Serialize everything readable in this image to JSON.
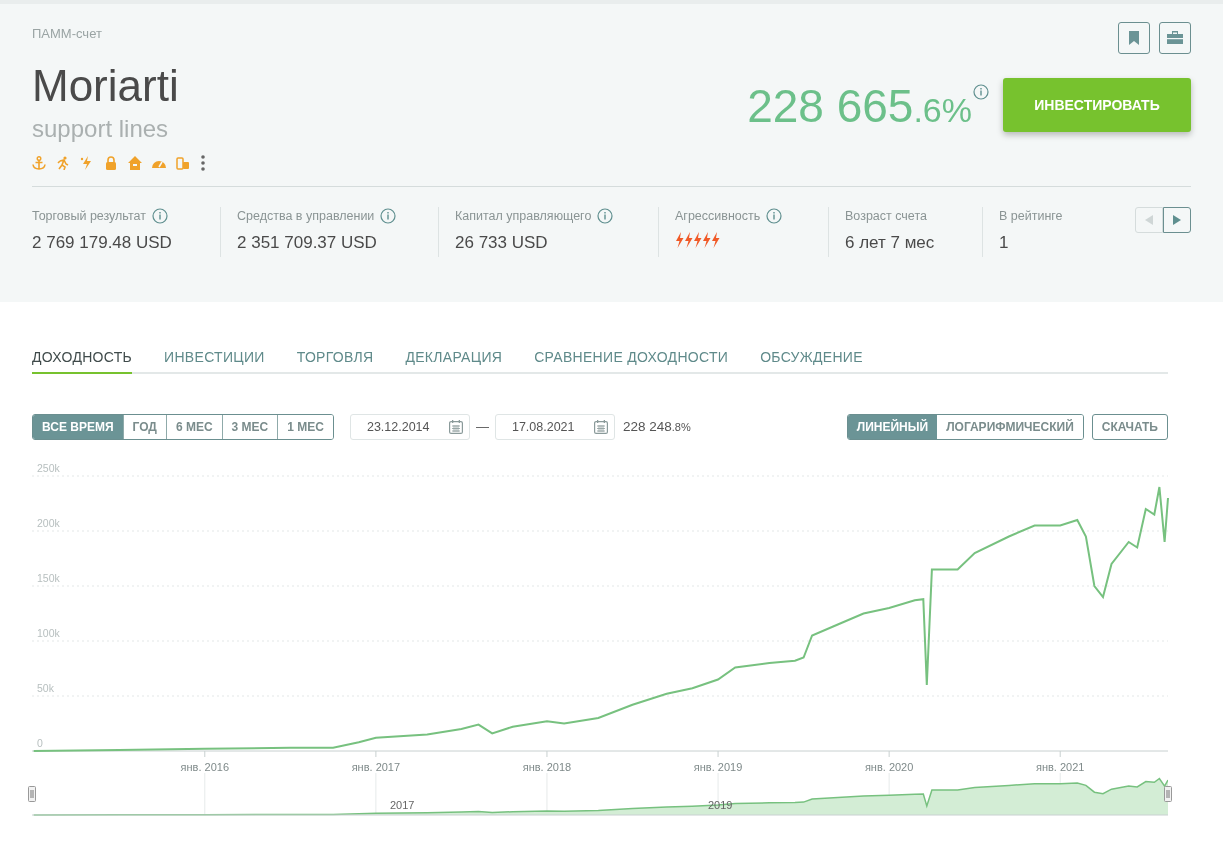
{
  "account_type": "ПАММ-счет",
  "title": "Moriarti",
  "subtitle": "support lines",
  "return": {
    "main": "228 665",
    "fraction": ".6%"
  },
  "invest_button": "ИНВЕСТИРОВАТЬ",
  "stats": [
    {
      "label": "Торговый результат",
      "info": true,
      "kind": "text",
      "value": "2 769 179.48 USD"
    },
    {
      "label": "Средства в управлении",
      "info": true,
      "kind": "text",
      "value": "2 351 709.37 USD"
    },
    {
      "label": "Капитал управляющего",
      "info": true,
      "kind": "text",
      "value": "26 733 USD"
    },
    {
      "label": "Агрессивность",
      "info": true,
      "kind": "bolts",
      "stars": 5
    },
    {
      "label": "Возраст счета",
      "info": false,
      "kind": "text",
      "value": "6 лет 7 мес"
    },
    {
      "label": "В рейтинге",
      "info": false,
      "kind": "text",
      "value": "1"
    }
  ],
  "stats_pager": {
    "prev_disabled": true,
    "next_disabled": false
  },
  "tabs": [
    {
      "label": "ДОХОДНОСТЬ",
      "selected": true
    },
    {
      "label": "ИНВЕСТИЦИИ",
      "selected": false
    },
    {
      "label": "ТОРГОВЛЯ",
      "selected": false
    },
    {
      "label": "ДЕКЛАРАЦИЯ",
      "selected": false
    },
    {
      "label": "СРАВНЕНИЕ ДОХОДНОСТИ",
      "selected": false
    },
    {
      "label": "ОБСУЖДЕНИЕ",
      "selected": false
    }
  ],
  "periods": [
    {
      "label": "ВСЕ ВРЕМЯ",
      "selected": true
    },
    {
      "label": "ГОД",
      "selected": false
    },
    {
      "label": "6 МЕС",
      "selected": false
    },
    {
      "label": "3 МЕС",
      "selected": false
    },
    {
      "label": "1 МЕС",
      "selected": false
    }
  ],
  "date_from": "23.12.2014",
  "date_separator": "—",
  "date_to": "17.08.2021",
  "period_return": {
    "main": "228 248",
    "fraction": ".8%"
  },
  "scales": [
    {
      "label": "ЛИНЕЙНЫЙ",
      "selected": true
    },
    {
      "label": "ЛОГАРИФМИЧЕСКИЙ",
      "selected": false
    }
  ],
  "download_button": "СКАЧАТЬ",
  "chart_data": {
    "type": "line",
    "x": [
      2015.0,
      2015.5,
      2016.0,
      2016.5,
      2016.75,
      2016.9,
      2017.0,
      2017.3,
      2017.5,
      2017.6,
      2017.68,
      2017.8,
      2018.0,
      2018.1,
      2018.3,
      2018.5,
      2018.7,
      2018.85,
      2019.0,
      2019.1,
      2019.3,
      2019.45,
      2019.5,
      2019.55,
      2019.7,
      2019.85,
      2020.0,
      2020.15,
      2020.2,
      2020.22,
      2020.25,
      2020.4,
      2020.5,
      2020.7,
      2020.85,
      2021.0,
      2021.1,
      2021.15,
      2021.2,
      2021.25,
      2021.3,
      2021.4,
      2021.45,
      2021.5,
      2021.55,
      2021.58,
      2021.61,
      2021.63
    ],
    "series": [
      {
        "color": "#77c17f",
        "values": [
          0,
          1000,
          2000,
          3000,
          3000,
          8000,
          12000,
          15000,
          20000,
          24000,
          16000,
          22000,
          27000,
          25000,
          30000,
          42000,
          52000,
          57000,
          65000,
          76000,
          80000,
          82000,
          85000,
          105000,
          115000,
          125000,
          130000,
          137000,
          138000,
          60000,
          165000,
          165000,
          180000,
          195000,
          205000,
          205000,
          210000,
          195000,
          150000,
          140000,
          170000,
          190000,
          185000,
          220000,
          215000,
          240000,
          190000,
          230000
        ]
      }
    ],
    "xlim": [
      2014.99,
      2021.63
    ],
    "ylim": [
      0,
      250000
    ],
    "grid": true,
    "xticks": [
      {
        "value": 2016,
        "label": "янв. 2016"
      },
      {
        "value": 2017,
        "label": "янв. 2017"
      },
      {
        "value": 2018,
        "label": "янв. 2018"
      },
      {
        "value": 2019,
        "label": "янв. 2019"
      },
      {
        "value": 2020,
        "label": "янв. 2020"
      },
      {
        "value": 2021,
        "label": "янв. 2021"
      }
    ],
    "yticks": [
      {
        "value": 0,
        "label": "0"
      },
      {
        "value": 50000,
        "label": "50k"
      },
      {
        "value": 100000,
        "label": "100k"
      },
      {
        "value": 150000,
        "label": "150k"
      },
      {
        "value": 200000,
        "label": "200k"
      },
      {
        "value": 250000,
        "label": "250k"
      }
    ]
  },
  "navigator_labels": [
    "2017",
    "2019"
  ]
}
